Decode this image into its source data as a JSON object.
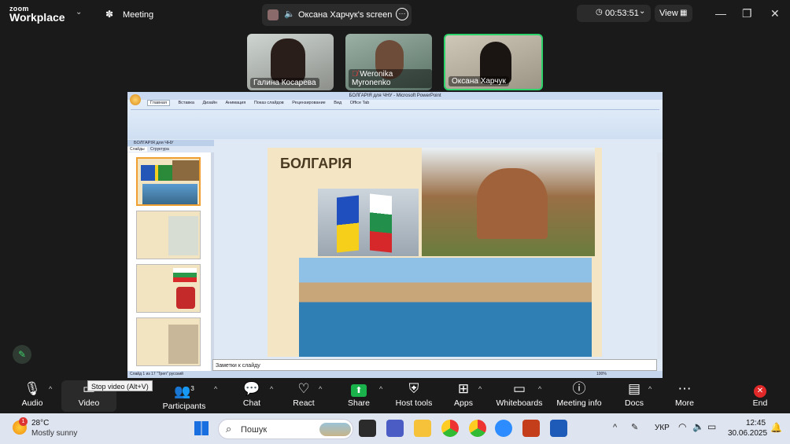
{
  "app": {
    "brand_top": "zoom",
    "brand_bottom": "Workplace",
    "meeting_label": "Meeting"
  },
  "share": {
    "label": "Оксана Харчук's screen"
  },
  "timer": {
    "value": "00:53:51"
  },
  "view": {
    "label": "View"
  },
  "participants": [
    {
      "name": "Галина Косарева"
    },
    {
      "name": "Weronika Myronenko"
    },
    {
      "name": "Оксана Харчук"
    }
  ],
  "ppt": {
    "title": "БОЛГАРІЯ для ЧНУ - Microsoft PowerPoint",
    "tabs": [
      "Главная",
      "Вставка",
      "Дизайн",
      "Анимация",
      "Показ слайдов",
      "Рецензирование",
      "Вид",
      "Office Tab"
    ],
    "doc_tab": "БОЛГАРІЯ для ЧНУ",
    "pane_tabs": [
      "Слайды",
      "Структура"
    ],
    "slide_title": "БОЛГАРІЯ",
    "notes_placeholder": "Заметки к слайду",
    "status_left": "Слайд 1 из 17   \"Треп\"   русский",
    "zoom": "100%"
  },
  "toolbar": {
    "items": [
      {
        "label": "Audio",
        "icon": "microphone-icon"
      },
      {
        "label": "Video",
        "icon": "video-icon"
      },
      {
        "label": "Participants",
        "icon": "participants-icon",
        "count": "3"
      },
      {
        "label": "Chat",
        "icon": "chat-icon"
      },
      {
        "label": "React",
        "icon": "heart-icon"
      },
      {
        "label": "Share",
        "icon": "share-icon"
      },
      {
        "label": "Host tools",
        "icon": "shield-icon"
      },
      {
        "label": "Apps",
        "icon": "apps-icon"
      },
      {
        "label": "Whiteboards",
        "icon": "whiteboard-icon"
      },
      {
        "label": "Meeting info",
        "icon": "info-icon"
      },
      {
        "label": "Docs",
        "icon": "docs-icon"
      },
      {
        "label": "More",
        "icon": "more-icon"
      },
      {
        "label": "End",
        "icon": "end-icon"
      }
    ],
    "tooltip": "Stop video (Alt+V)"
  },
  "taskbar": {
    "weather_temp": "28°C",
    "weather_desc": "Mostly sunny",
    "search_placeholder": "Пошук",
    "lang": "УКР",
    "time": "12:45",
    "date": "30.06.2025"
  },
  "colors": {
    "accent_green": "#10b981",
    "end_red": "#e02828",
    "share_green": "#19b24b"
  }
}
